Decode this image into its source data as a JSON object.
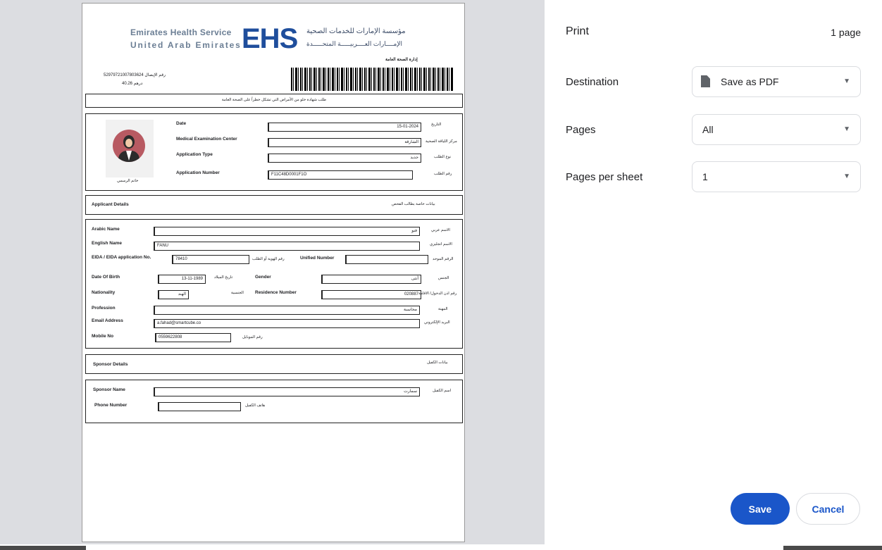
{
  "print_dialog": {
    "title": "Print",
    "page_count": "1 page",
    "destination": {
      "label": "Destination",
      "value": "Save as PDF"
    },
    "pages": {
      "label": "Pages",
      "value": "All"
    },
    "pages_per_sheet": {
      "label": "Pages per sheet",
      "value": "1"
    },
    "save_label": "Save",
    "cancel_label": "Cancel",
    "accent_color": "#1a56c9",
    "icons": {
      "destination": "document-icon",
      "dropdown": "chevron-down-icon"
    }
  },
  "document": {
    "header": {
      "org_en_line1": "Emirates Health Service",
      "org_en_line2": "United  Arab  Emirates",
      "logo": "EHS",
      "org_ar_line1": "مؤسسة الإمارات للخدمات الصحية",
      "org_ar_line2": "الإمــــارات العــــربيـــــة المتحـــــدة",
      "org_ar_line3": "إدارة الصحة العامة",
      "receipt": "52979721007803624 رقم الإيصال",
      "fee": "40.26 درهم"
    },
    "request_title": "طلب شهادة خلو من الأمراض التي تشكل خطراً على الصحة العامة",
    "top_section": {
      "photo_caption": "خاتم الرسمي",
      "date": {
        "label": "Date",
        "value": "15-01-2024",
        "ar": "التاريخ"
      },
      "exam_center": {
        "label": "Medical Examination Center",
        "value": "الشارقة",
        "ar": "مركز اللياقة الصحية"
      },
      "app_type": {
        "label": "Application Type",
        "value": "جديد",
        "ar": "نوع الطلب"
      },
      "app_number": {
        "label": "Application Number",
        "value": "F11C48D0001F1O",
        "ar": "رقم الطلب"
      }
    },
    "applicant_header": {
      "en": "Applicant Details",
      "ar": "بيانات خاصة بطالب الفحص"
    },
    "applicant": {
      "arabic_name": {
        "label": "Arabic Name",
        "value": "فنو",
        "ar": "الاسم عربي"
      },
      "english_name": {
        "label": "English Name",
        "value": "FANU",
        "ar": "الاسم انجليزي"
      },
      "eida": {
        "label": "EIDA / EIDA application No.",
        "value": "78410",
        "ar": "رقم الهوية أو الطلب"
      },
      "unified": {
        "label": "Unified Number",
        "value": "",
        "ar": "الرقم الموحد"
      },
      "dob": {
        "label": "Date Of Birth",
        "value": "13-11-1989",
        "ar": "تاريخ الميلاد"
      },
      "gender": {
        "label": "Gender",
        "value": "أنثى",
        "ar": "الجنس"
      },
      "nationality": {
        "label": "Nationality",
        "value": "الهند",
        "ar": "الجنسية"
      },
      "residence": {
        "label": "Residence Number",
        "value": "020887",
        "ar": "رقم اذن الدخول/ الاقامة"
      },
      "profession": {
        "label": "Profession",
        "value": "محاسبة",
        "ar": "المهنة"
      },
      "email": {
        "label": "Email Address",
        "value": "a.fahad@smartcube.co",
        "ar": "البريد الإلكتروني"
      },
      "mobile": {
        "label": "Mobile No",
        "value": "0559622808",
        "ar": "رقم الموبايل"
      }
    },
    "sponsor_header": {
      "en": "Sponsor Details",
      "ar": "بيانات الكفيل"
    },
    "sponsor": {
      "name": {
        "label": "Sponsor Name",
        "value": "سمارت",
        "ar": "اسم الكفيل"
      },
      "phone": {
        "label": "Phone Number",
        "value": "",
        "ar": "هاتف الكفيل"
      }
    }
  }
}
